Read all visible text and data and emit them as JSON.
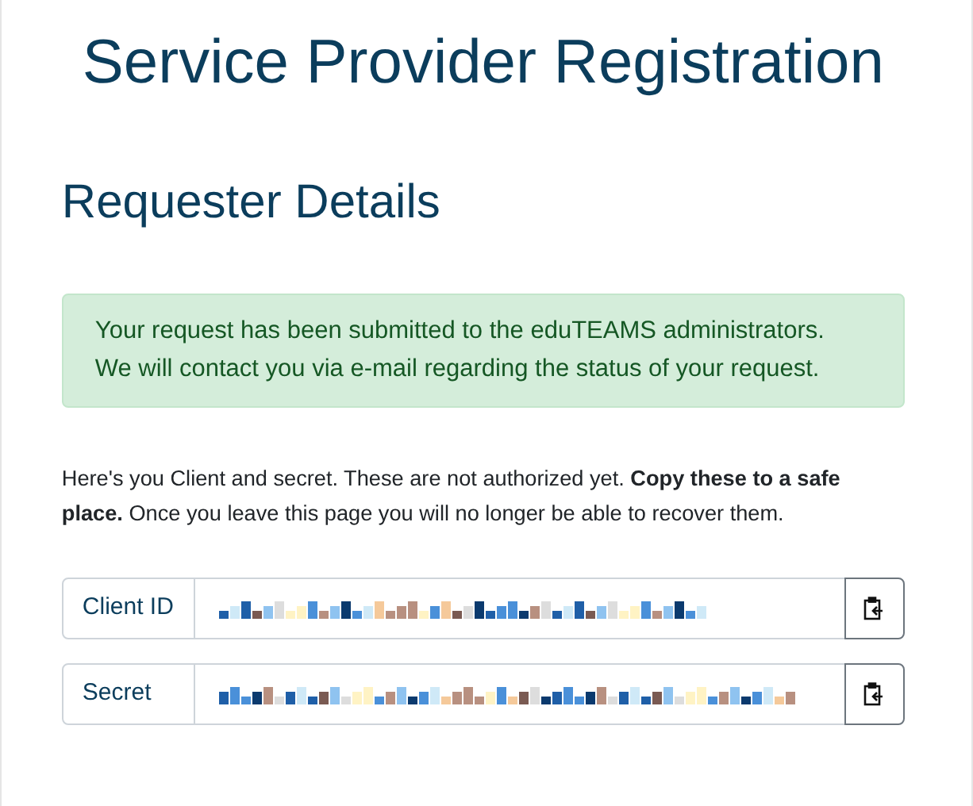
{
  "page_title": "Service Provider Registration",
  "section_heading": "Requester Details",
  "alert": {
    "lines": [
      "Your request has been submitted to the eduTEAMS administrators.",
      "We will contact you via e-mail regarding the status of your request."
    ]
  },
  "notice": "Here's you Client and secret. These are not authorized yet. **Copy these to a safe place.** Once you leave this page you will no longer be able to recover them.",
  "credentials": [
    {
      "label": "Client ID"
    },
    {
      "label": "Secret"
    }
  ]
}
